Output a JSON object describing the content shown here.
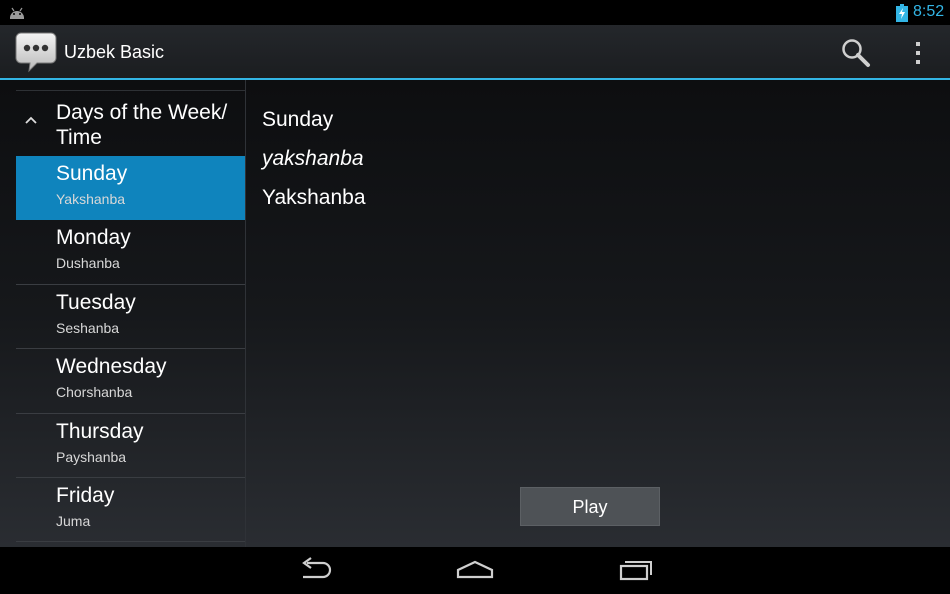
{
  "status_bar": {
    "time": "8:52",
    "icons": [
      "android-icon",
      "battery-charging-icon"
    ],
    "accent_color": "#33b5e5"
  },
  "action_bar": {
    "title": "Uzbek Basic",
    "icons": [
      "chat-bubble-app-icon",
      "search-icon",
      "overflow-menu-icon"
    ]
  },
  "sidebar": {
    "group_title": "Days of the Week/ Time",
    "items": [
      {
        "label": "Sunday",
        "sublabel": "Yakshanba",
        "selected": true
      },
      {
        "label": "Monday",
        "sublabel": "Dushanba",
        "selected": false
      },
      {
        "label": "Tuesday",
        "sublabel": "Seshanba",
        "selected": false
      },
      {
        "label": "Wednesday",
        "sublabel": "Chorshanba",
        "selected": false
      },
      {
        "label": "Thursday",
        "sublabel": "Payshanba",
        "selected": false
      },
      {
        "label": "Friday",
        "sublabel": "Juma",
        "selected": false
      }
    ],
    "selected_color": "#0f84bd"
  },
  "detail": {
    "english": "Sunday",
    "transliteration": "yakshanba",
    "native": "Yakshanba"
  },
  "play_button": {
    "label": "Play"
  },
  "nav_bar": {
    "icons": [
      "back-icon",
      "home-icon",
      "recent-apps-icon"
    ]
  }
}
